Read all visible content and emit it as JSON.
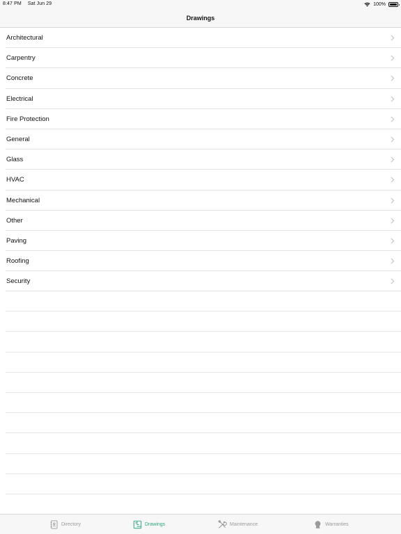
{
  "status_bar": {
    "time": "8:47 PM",
    "date": "Sat Jun 29",
    "battery": "100%"
  },
  "nav": {
    "title": "Drawings"
  },
  "list": {
    "items": [
      {
        "label": "Architectural"
      },
      {
        "label": "Carpentry"
      },
      {
        "label": "Concrete"
      },
      {
        "label": "Electrical"
      },
      {
        "label": "Fire Protection"
      },
      {
        "label": "General"
      },
      {
        "label": "Glass"
      },
      {
        "label": "HVAC"
      },
      {
        "label": "Mechanical"
      },
      {
        "label": "Other"
      },
      {
        "label": "Paving"
      },
      {
        "label": "Roofing"
      },
      {
        "label": "Security"
      }
    ]
  },
  "tabs": [
    {
      "label": "Directory",
      "icon": "contacts-book-icon",
      "active": false
    },
    {
      "label": "Drawings",
      "icon": "blueprint-icon",
      "active": true
    },
    {
      "label": "Maintenance",
      "icon": "tools-icon",
      "active": false
    },
    {
      "label": "Warranties",
      "icon": "ribbon-badge-icon",
      "active": false
    }
  ],
  "colors": {
    "accent": "#2aa87a",
    "inactive": "#9a9a9a",
    "chevron": "#c4c4c4"
  }
}
